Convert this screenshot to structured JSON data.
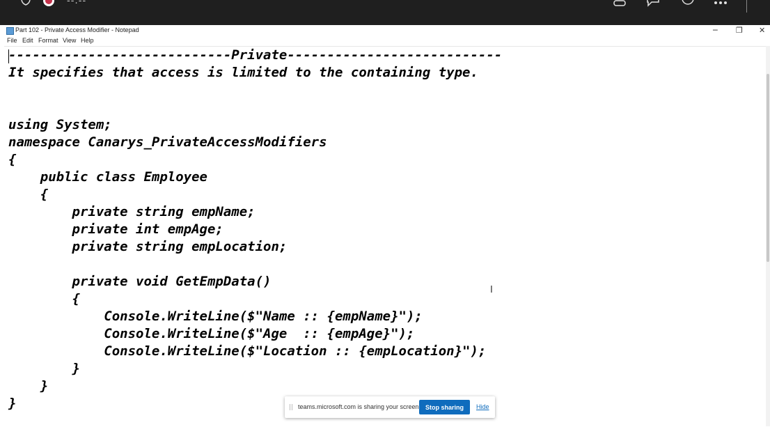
{
  "teams_bar": {
    "timer": "--:--",
    "icons": [
      "shield-icon",
      "record-icon",
      "people-icon",
      "chat-icon",
      "reactions-icon",
      "more-icon"
    ],
    "record_color": "#c4314b"
  },
  "window": {
    "title": "Part 102 - Private Access Modifier - Notepad",
    "minimize": "─",
    "maximize": "❐",
    "close": "✕"
  },
  "menu": {
    "file": "File",
    "edit": "Edit",
    "format": "Format",
    "view": "View",
    "help": "Help"
  },
  "editor": {
    "lines": [
      "----------------------------Private---------------------------",
      "It specifies that access is limited to the containing type.",
      "",
      "",
      "using System;",
      "namespace Canarys_PrivateAccessModifiers",
      "{",
      "    public class Employee",
      "    {",
      "        private string empName;",
      "        private int empAge;",
      "        private string empLocation;",
      "",
      "        private void GetEmpData()",
      "        {",
      "            Console.WriteLine($\"Name :: {empName}\");",
      "            Console.WriteLine($\"Age  :: {empAge}\");",
      "            Console.WriteLine($\"Location :: {empLocation}\");",
      "        }",
      "    }",
      "}"
    ]
  },
  "share_toast": {
    "message": "teams.microsoft.com is sharing your screen.",
    "stop_label": "Stop sharing",
    "hide_label": "Hide",
    "accent": "#0f6cbd"
  }
}
